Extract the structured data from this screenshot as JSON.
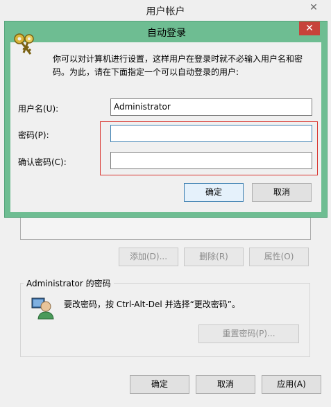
{
  "background_window": {
    "title": "用户帐户",
    "close_glyph": "✕",
    "buttons": {
      "add": "添加(D)...",
      "remove": "删除(R)",
      "properties": "属性(O)"
    },
    "password_group": {
      "title": "Administrator 的密码",
      "hint": "要改密码，按 Ctrl-Alt-Del 并选择“更改密码”。",
      "reset_button": "重置密码(P)..."
    },
    "footer": {
      "ok": "确定",
      "cancel": "取消",
      "apply": "应用(A)"
    }
  },
  "auto_logon_dialog": {
    "title": "自动登录",
    "close_glyph": "✕",
    "description": "你可以对计算机进行设置，这样用户在登录时就不必输入用户名和密码。为此，请在下面指定一个可以自动登录的用户:",
    "username_label": "用户名(U):",
    "username_value": "Administrator",
    "password_label": "密码(P):",
    "password_value": "",
    "confirm_label": "确认密码(C):",
    "confirm_value": "",
    "ok": "确定",
    "cancel": "取消"
  },
  "colors": {
    "dialog_frame": "#6ebd92",
    "close_button": "#c7433a",
    "highlight_box": "#d9352f",
    "default_button_border": "#3c7fb1"
  },
  "icons": [
    "keys-icon",
    "user-icon",
    "close-icon"
  ]
}
